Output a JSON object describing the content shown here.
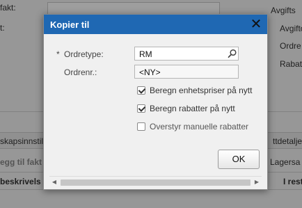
{
  "background": {
    "frag_fakt": "fakt:",
    "frag_colon": "t:",
    "avgift1": "Avgifts",
    "avgift2": "Avgifto",
    "ordre": "Ordre",
    "rabatt": "Rabatt",
    "tab_left": "skapsinnstil",
    "tab_right": "ttdetaljer",
    "legg_til": "egg til fakt",
    "lagersa": "Lagersa",
    "beskrivelse": "beskrivels",
    "i_rest": "I rest"
  },
  "dialog": {
    "title": "Kopier til",
    "close_symbol": "✕",
    "required_mark": "*",
    "ordretype_label": "Ordretype:",
    "ordretype_value": "RM",
    "ordrenr_label": "Ordrenr.:",
    "ordrenr_value": "<NY>",
    "checkboxes": [
      {
        "label": "Beregn enhetspriser på nytt",
        "checked": true
      },
      {
        "label": "Beregn rabatter på nytt",
        "checked": true
      },
      {
        "label": "Overstyr manuelle rabatter",
        "checked": false
      }
    ],
    "ok_label": "OK",
    "scroll_left": "◀",
    "scroll_right": "▶"
  },
  "colors": {
    "titlebar": "#1f68b3",
    "overlay": "rgba(0,0,0,0.38)"
  },
  "icons": {
    "close": "close-icon",
    "search": "search-icon",
    "scroll_left": "arrow-left-icon",
    "scroll_right": "arrow-right-icon"
  }
}
